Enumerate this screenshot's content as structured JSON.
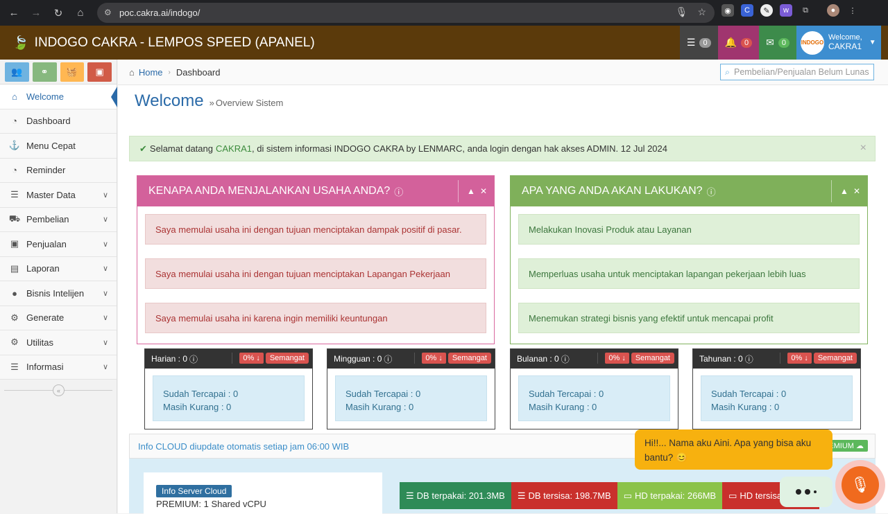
{
  "browser": {
    "url": "poc.cakra.ai/indogo/"
  },
  "topnav": {
    "brand": "INDOGO CAKRA - LEMPOS SPEED (APANEL)",
    "tasks_count": "0",
    "notifications_count": "0",
    "messages_count": "0",
    "welcome_label": "Welcome,",
    "username": "CAKRA1",
    "avatar_text": "INDOGO"
  },
  "sidebar": {
    "items": [
      {
        "label": "Welcome"
      },
      {
        "label": "Dashboard"
      },
      {
        "label": "Menu Cepat"
      },
      {
        "label": "Reminder"
      },
      {
        "label": "Master Data"
      },
      {
        "label": "Pembelian"
      },
      {
        "label": "Penjualan"
      },
      {
        "label": "Laporan"
      },
      {
        "label": "Bisnis Intelijen"
      },
      {
        "label": "Generate"
      },
      {
        "label": "Utilitas"
      },
      {
        "label": "Informasi"
      }
    ]
  },
  "breadcrumb": {
    "home": "Home",
    "current": "Dashboard"
  },
  "search": {
    "placeholder": "Pembelian/Penjualan Belum Lunas"
  },
  "page": {
    "title": "Welcome",
    "subtitle": "Overview Sistem"
  },
  "alert": {
    "prefix": "Selamat datang",
    "user": "CAKRA1",
    "suffix": ", di sistem informasi INDOGO CAKRA by LENMARC, anda login dengan hak akses ADMIN. 12 Jul 2024"
  },
  "widget_why": {
    "title": "KENAPA ANDA MENJALANKAN USAHA ANDA?",
    "items": [
      "Saya memulai usaha ini dengan tujuan menciptakan dampak positif di pasar.",
      "Saya memulai usaha ini dengan tujuan menciptakan Lapangan Pekerjaan",
      "Saya memulai usaha ini karena ingin memiliki keuntungan"
    ]
  },
  "widget_what": {
    "title": "APA YANG ANDA AKAN LAKUKAN?",
    "items": [
      "Melakukan Inovasi Produk atau Layanan",
      "Memperluas usaha untuk menciptakan lapangan pekerjaan lebih luas",
      "Menemukan strategi bisnis yang efektif untuk mencapai profit"
    ]
  },
  "targets": [
    {
      "label": "Harian : 0",
      "pct": "0%",
      "badge": "Semangat",
      "achieved": "Sudah Tercapai : 0",
      "remaining": "Masih Kurang : 0"
    },
    {
      "label": "Mingguan : 0",
      "pct": "0%",
      "badge": "Semangat",
      "achieved": "Sudah Tercapai : 0",
      "remaining": "Masih Kurang : 0"
    },
    {
      "label": "Bulanan : 0",
      "pct": "0%",
      "badge": "Semangat",
      "achieved": "Sudah Tercapai : 0",
      "remaining": "Masih Kurang : 0"
    },
    {
      "label": "Tahunan : 0",
      "pct": "0%",
      "badge": "Semangat",
      "achieved": "Sudah Tercapai : 0",
      "remaining": "Masih Kurang : 0"
    }
  ],
  "cloud": {
    "info": "Info CLOUD diupdate otomatis setiap jam 06:00 WIB",
    "premium_badge": "PREMIUM",
    "server_tag": "Info Server Cloud",
    "server_line": "PREMIUM: 1 Shared vCPU",
    "stats": [
      {
        "label": "DB terpakai: 201.3MB",
        "color": "#2e8b57"
      },
      {
        "label": "DB tersisa: 198.7MB",
        "color": "#c9302c"
      },
      {
        "label": "HD terpakai: 266MB",
        "color": "#8bc34a"
      },
      {
        "label": "HD tersisa:",
        "color": "#c9302c"
      }
    ]
  },
  "chat": {
    "message": "Hi!!... Nama aku Aini. Apa yang bisa aku bantu? 😊"
  }
}
